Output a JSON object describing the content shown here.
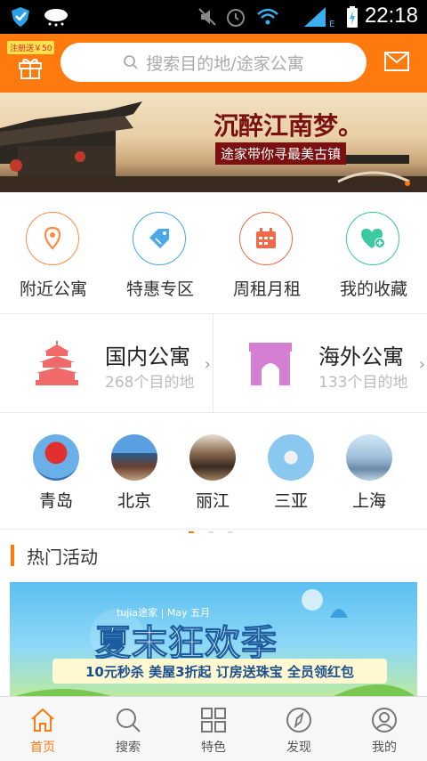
{
  "statusbar": {
    "time": "22:18"
  },
  "header": {
    "gift_badge": "注册送￥50",
    "search_placeholder": "搜索目的地/途家公寓",
    "accent": "#ff7a0e"
  },
  "banner": {
    "title": "沉醉江南梦。",
    "subtitle": "途家带你寻最美古镇"
  },
  "quick_links": [
    {
      "label": "附近公寓",
      "icon": "location-pin-icon",
      "color": "#ff8a40"
    },
    {
      "label": "特惠专区",
      "icon": "price-tag-icon",
      "color": "#4aa8e8"
    },
    {
      "label": "周租月租",
      "icon": "calendar-icon",
      "color": "#f06a4a"
    },
    {
      "label": "我的收藏",
      "icon": "heart-plus-icon",
      "color": "#3cc8a0"
    }
  ],
  "regions": [
    {
      "title": "国内公寓",
      "subtitle": "268个目的地",
      "icon": "temple-of-heaven-icon"
    },
    {
      "title": "海外公寓",
      "subtitle": "133个目的地",
      "icon": "arc-de-triomphe-icon"
    }
  ],
  "cities": [
    {
      "name": "青岛"
    },
    {
      "name": "北京"
    },
    {
      "name": "丽江"
    },
    {
      "name": "三亚"
    },
    {
      "name": "上海"
    }
  ],
  "hot": {
    "title": "热门活动"
  },
  "promo": {
    "brand": "tujia途家 | May 五月",
    "headline": "夏末狂欢季",
    "strip": "10元秒杀  美屋3折起  订房送珠宝  全员领红包"
  },
  "tabs": [
    {
      "label": "首页",
      "icon": "home-icon",
      "active": true
    },
    {
      "label": "搜索",
      "icon": "search-icon",
      "active": false
    },
    {
      "label": "特色",
      "icon": "grid-icon",
      "active": false
    },
    {
      "label": "发现",
      "icon": "compass-icon",
      "active": false
    },
    {
      "label": "我的",
      "icon": "profile-icon",
      "active": false
    }
  ]
}
